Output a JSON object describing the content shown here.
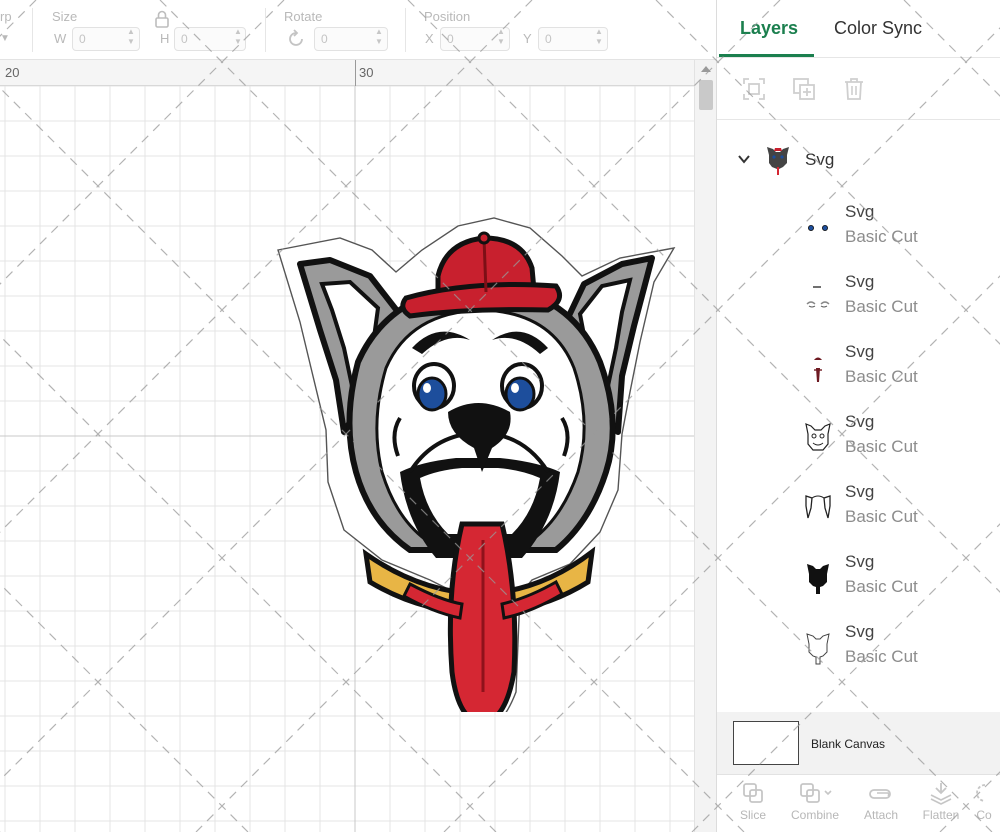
{
  "toolbar": {
    "partial_label": "rp",
    "partial_value": "",
    "size_label": "Size",
    "width_axis": "W",
    "width_value": "0",
    "height_axis": "H",
    "height_value": "0",
    "rotate_label": "Rotate",
    "rotate_value": "0",
    "position_label": "Position",
    "x_axis": "X",
    "x_value": "0",
    "y_axis": "Y",
    "y_value": "0"
  },
  "ruler": {
    "marks": [
      "20",
      "30"
    ]
  },
  "artwork": {
    "colors": {
      "cap": "#c8202e",
      "tongue": "#d52733",
      "collar": "#e8b545",
      "fur": "#999999",
      "eyes": "#1d4e9c",
      "outline": "#111111"
    }
  },
  "panel": {
    "tabs": [
      {
        "label": "Layers",
        "active": true
      },
      {
        "label": "Color Sync",
        "active": false
      }
    ],
    "group": {
      "name": "Svg"
    },
    "layers": [
      {
        "name": "Svg",
        "type": "Basic Cut",
        "thumb": "eyes-thumb-icon"
      },
      {
        "name": "Svg",
        "type": "Basic Cut",
        "thumb": "brows-thumb-icon"
      },
      {
        "name": "Svg",
        "type": "Basic Cut",
        "thumb": "cap-tongue-thumb-icon"
      },
      {
        "name": "Svg",
        "type": "Basic Cut",
        "thumb": "face-lines-thumb-icon"
      },
      {
        "name": "Svg",
        "type": "Basic Cut",
        "thumb": "ears-thumb-icon"
      },
      {
        "name": "Svg",
        "type": "Basic Cut",
        "thumb": "silhouette-thumb-icon"
      },
      {
        "name": "Svg",
        "type": "Basic Cut",
        "thumb": "outline-thumb-icon"
      }
    ],
    "blank_canvas_label": "Blank Canvas",
    "bottom_tools": [
      {
        "label": "Slice",
        "icon": "slice-icon"
      },
      {
        "label": "Combine",
        "icon": "combine-icon"
      },
      {
        "label": "Attach",
        "icon": "attach-icon"
      },
      {
        "label": "Flatten",
        "icon": "flatten-icon"
      },
      {
        "label": "Co",
        "icon": "contour-icon"
      }
    ],
    "accent_color": "#1b7f4e"
  }
}
